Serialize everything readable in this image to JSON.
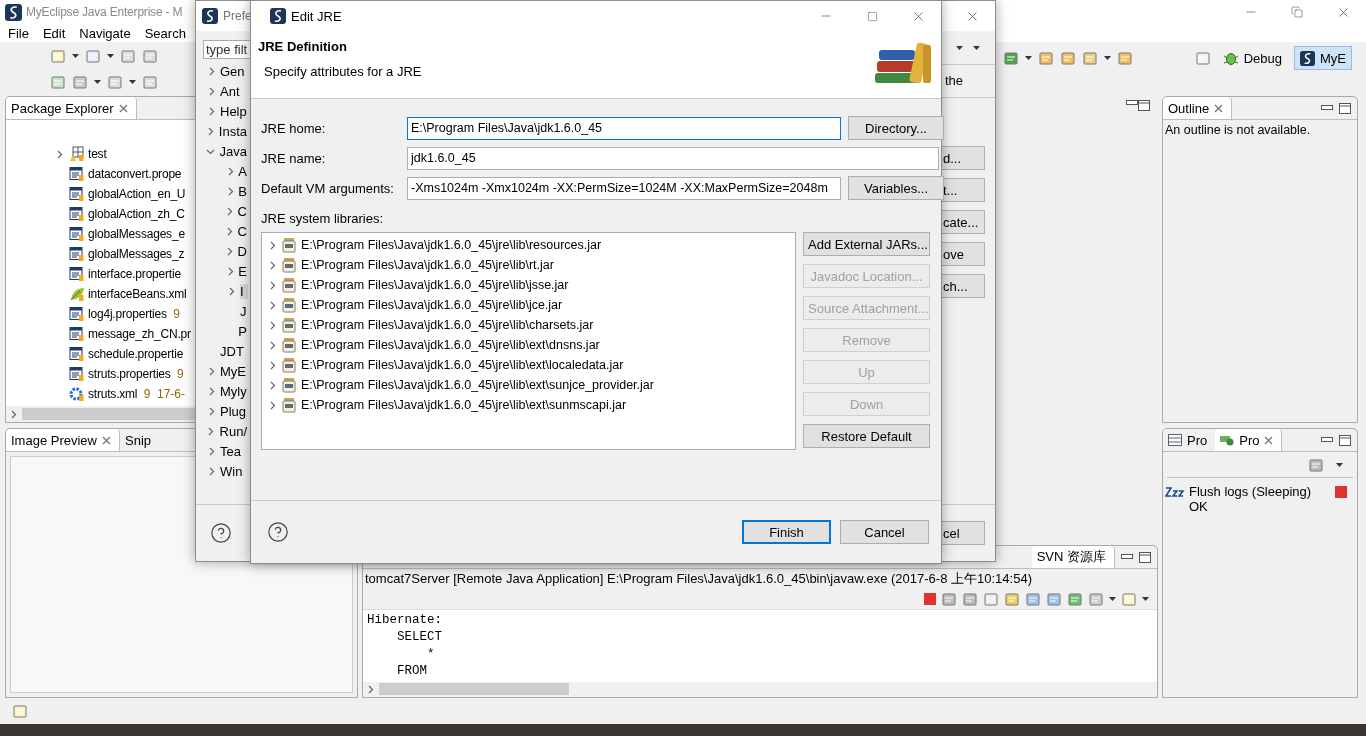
{
  "ide": {
    "title": "MyEclipse Java Enterprise - M",
    "menu": [
      "File",
      "Edit",
      "Navigate",
      "Search"
    ],
    "perspectives": [
      {
        "label": "Debug",
        "kind": "debug",
        "selected": false
      },
      {
        "label": "MyE",
        "kind": "myeclipse",
        "selected": true
      }
    ],
    "package_explorer": {
      "tabs": [
        {
          "label": "Package Explorer",
          "selected": true
        }
      ],
      "items": [
        {
          "label": "test",
          "kind": "package",
          "expanded": false
        },
        {
          "label": "dataconvert.prope",
          "kind": "properties"
        },
        {
          "label": "globalAction_en_U",
          "kind": "properties"
        },
        {
          "label": "globalAction_zh_C",
          "kind": "properties"
        },
        {
          "label": "globalMessages_e",
          "kind": "properties"
        },
        {
          "label": "globalMessages_z",
          "kind": "properties"
        },
        {
          "label": "interface.propertie",
          "kind": "properties"
        },
        {
          "label": "interfaceBeans.xml",
          "kind": "xml"
        },
        {
          "label": "log4j.properties",
          "kind": "properties",
          "decoration": "9"
        },
        {
          "label": "message_zh_CN.pr",
          "kind": "properties"
        },
        {
          "label": "schedule.propertie",
          "kind": "properties"
        },
        {
          "label": "struts.properties",
          "kind": "properties",
          "decoration": "9"
        },
        {
          "label": "struts.xml",
          "kind": "config",
          "decoration": "9  17-6-"
        }
      ]
    },
    "image_preview": {
      "tabs": [
        {
          "label": "Image Preview",
          "selected": true
        },
        {
          "label": "Snip",
          "selected": false
        }
      ]
    },
    "outline": {
      "tab": "Outline",
      "message": "An outline is not available."
    },
    "progress": {
      "tabs": [
        {
          "label": "Pro",
          "kind": "table",
          "selected": false
        },
        {
          "label": "Pro",
          "kind": "progress",
          "selected": true
        }
      ],
      "items": [
        {
          "title": "Flush logs (Sleeping)",
          "status": "OK"
        }
      ]
    },
    "console": {
      "tabs": [
        {
          "label": "SVN 资源库"
        }
      ],
      "header": "tomcat7Server [Remote Java Application] E:\\Program Files\\Java\\jdk1.6.0_45\\bin\\javaw.exe (2017-6-8 上午10:14:54)",
      "lines": [
        "Hibernate:",
        "    SELECT",
        "        *",
        "    FROM"
      ]
    }
  },
  "preferences": {
    "title": "Prefe",
    "filter": {
      "placeholder": "type filt"
    },
    "tree": [
      {
        "label": "Gen",
        "expanded": false
      },
      {
        "label": "Ant",
        "expanded": false
      },
      {
        "label": "Help",
        "expanded": false
      },
      {
        "label": "Insta",
        "expanded": false
      },
      {
        "label": "Java",
        "expanded": true,
        "children": [
          {
            "label": "A",
            "expanded": false,
            "selected": false
          },
          {
            "label": "B",
            "expanded": false,
            "selected": false
          },
          {
            "label": "C",
            "expanded": false,
            "selected": false
          },
          {
            "label": "C",
            "expanded": false,
            "selected": false
          },
          {
            "label": "D",
            "expanded": false,
            "selected": false
          },
          {
            "label": "E",
            "expanded": false,
            "selected": false
          },
          {
            "label": "I",
            "expanded": false,
            "selected": true
          },
          {
            "label": "J",
            "selected": false
          },
          {
            "label": "P",
            "selected": false
          }
        ]
      },
      {
        "label": "JDT"
      },
      {
        "label": "MyE",
        "expanded": false
      },
      {
        "label": "Myly",
        "expanded": false
      },
      {
        "label": "Plug",
        "expanded": false
      },
      {
        "label": "Run/",
        "expanded": false
      },
      {
        "label": "Tea",
        "expanded": false
      },
      {
        "label": "Win",
        "expanded": false
      }
    ],
    "description": "the",
    "buttons": [
      "d...",
      "t...",
      "cate...",
      "ove",
      "ch..."
    ],
    "footer_buttons": [
      "cel"
    ]
  },
  "edit_jre": {
    "title": "Edit JRE",
    "heading": "JRE Definition",
    "subheading": "Specify attributes for a JRE",
    "fields": [
      {
        "label": "JRE home:",
        "value": "E:\\Program Files\\Java\\jdk1.6.0_45",
        "focused": true,
        "button": "Directory..."
      },
      {
        "label": "JRE name:",
        "value": "jdk1.6.0_45",
        "focused": false
      },
      {
        "label": "Default VM arguments:",
        "value": "-Xms1024m -Xmx1024m -XX:PermSize=1024M -XX:MaxPermSize=2048m",
        "focused": false,
        "button": "Variables..."
      }
    ],
    "libraries_label": "JRE system libraries:",
    "libraries": [
      {
        "path": "E:\\Program Files\\Java\\jdk1.6.0_45\\jre\\lib\\resources.jar",
        "expanded": false
      },
      {
        "path": "E:\\Program Files\\Java\\jdk1.6.0_45\\jre\\lib\\rt.jar",
        "expanded": false
      },
      {
        "path": "E:\\Program Files\\Java\\jdk1.6.0_45\\jre\\lib\\jsse.jar",
        "expanded": false
      },
      {
        "path": "E:\\Program Files\\Java\\jdk1.6.0_45\\jre\\lib\\jce.jar",
        "expanded": false
      },
      {
        "path": "E:\\Program Files\\Java\\jdk1.6.0_45\\jre\\lib\\charsets.jar",
        "expanded": false
      },
      {
        "path": "E:\\Program Files\\Java\\jdk1.6.0_45\\jre\\lib\\ext\\dnsns.jar",
        "expanded": false
      },
      {
        "path": "E:\\Program Files\\Java\\jdk1.6.0_45\\jre\\lib\\ext\\localedata.jar",
        "expanded": false
      },
      {
        "path": "E:\\Program Files\\Java\\jdk1.6.0_45\\jre\\lib\\ext\\sunjce_provider.jar",
        "expanded": false
      },
      {
        "path": "E:\\Program Files\\Java\\jdk1.6.0_45\\jre\\lib\\ext\\sunmscapi.jar",
        "expanded": false
      }
    ],
    "library_buttons": [
      {
        "label": "Add External JARs...",
        "disabled": false
      },
      {
        "label": "Javadoc Location...",
        "disabled": true
      },
      {
        "label": "Source Attachment...",
        "disabled": true
      },
      {
        "label": "Remove",
        "disabled": true
      },
      {
        "label": "Up",
        "disabled": true
      },
      {
        "label": "Down",
        "disabled": true
      },
      {
        "label": "Restore Default",
        "disabled": false
      }
    ],
    "footer_buttons": [
      {
        "label": "Finish",
        "default": true
      },
      {
        "label": "Cancel",
        "default": false
      }
    ]
  }
}
